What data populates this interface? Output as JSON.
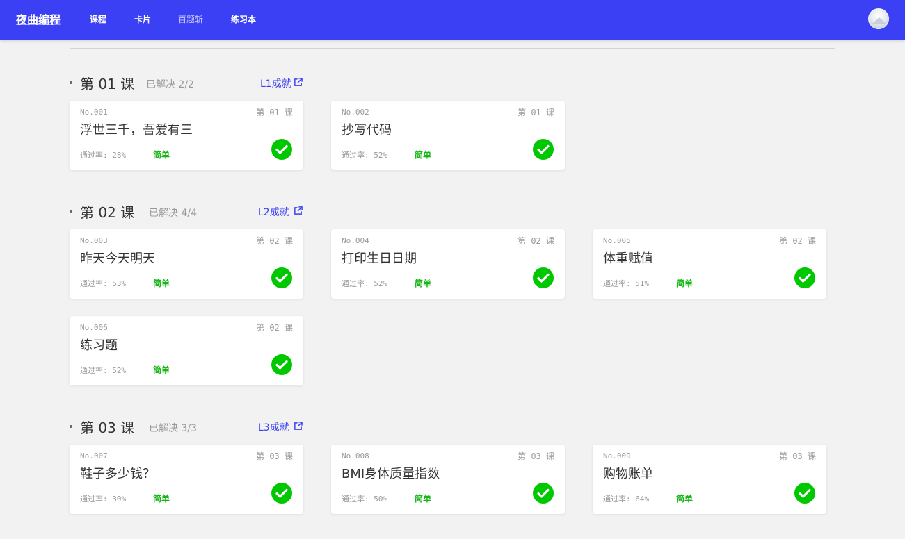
{
  "app": {
    "logo": "夜曲编程",
    "nav": [
      {
        "label": "课程"
      },
      {
        "label": "卡片"
      },
      {
        "label": "百题斩"
      },
      {
        "label": "练习本"
      }
    ]
  },
  "colors": {
    "brand": "#3b40f5",
    "success": "#00c800",
    "difficulty": "#16b616"
  },
  "icons": {
    "check": "check-circle-icon",
    "external": "external-link-icon"
  },
  "sections": [
    {
      "title": "第 01 课",
      "solved": "已解决 2/2",
      "achievement": "L1成就",
      "cards": [
        {
          "no": "No.001",
          "lesson": "第 01 课",
          "title": "浮世三千，吾爱有三",
          "rate": "通过率: 28%",
          "difficulty": "简单"
        },
        {
          "no": "No.002",
          "lesson": "第 01 课",
          "title": "抄写代码",
          "rate": "通过率: 52%",
          "difficulty": "简单"
        }
      ]
    },
    {
      "title": "第 02 课",
      "solved": "已解决 4/4",
      "achievement": "L2成就",
      "cards": [
        {
          "no": "No.003",
          "lesson": "第 02 课",
          "title": "昨天今天明天",
          "rate": "通过率: 53%",
          "difficulty": "简单"
        },
        {
          "no": "No.004",
          "lesson": "第 02 课",
          "title": "打印生日日期",
          "rate": "通过率: 52%",
          "difficulty": "简单"
        },
        {
          "no": "No.005",
          "lesson": "第 02 课",
          "title": "体重赋值",
          "rate": "通过率: 51%",
          "difficulty": "简单"
        },
        {
          "no": "No.006",
          "lesson": "第 02 课",
          "title": "练习题",
          "rate": "通过率: 52%",
          "difficulty": "简单"
        }
      ]
    },
    {
      "title": "第 03 课",
      "solved": "已解决 3/3",
      "achievement": "L3成就",
      "cards": [
        {
          "no": "No.007",
          "lesson": "第 03 课",
          "title": "鞋子多少钱？",
          "rate": "通过率: 30%",
          "difficulty": "简单"
        },
        {
          "no": "No.008",
          "lesson": "第 03 课",
          "title": "BMI身体质量指数",
          "rate": "通过率: 50%",
          "difficulty": "简单"
        },
        {
          "no": "No.009",
          "lesson": "第 03 课",
          "title": "购物账单",
          "rate": "通过率: 64%",
          "difficulty": "简单"
        }
      ]
    }
  ]
}
